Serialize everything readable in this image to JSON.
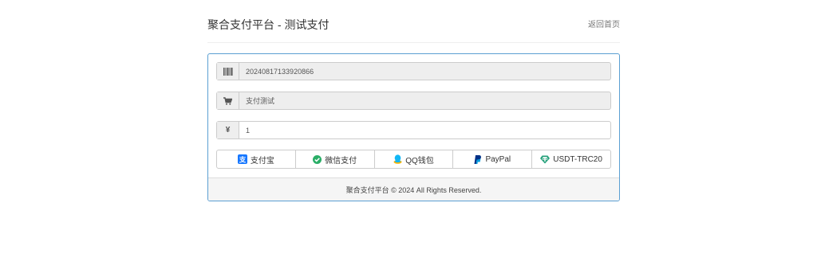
{
  "header": {
    "title": "聚合支付平台 - 测试支付",
    "back_link": "返回首页"
  },
  "form": {
    "order_no": {
      "icon": "barcode-icon",
      "value": "20240817133920866"
    },
    "subject": {
      "icon": "cart-icon",
      "value": "支付测试"
    },
    "amount": {
      "icon": "yen-icon",
      "symbol": "¥",
      "value": "1"
    }
  },
  "payments": [
    {
      "label": "支付宝",
      "icon": "alipay-icon",
      "color": "#1677ff"
    },
    {
      "label": "微信支付",
      "icon": "wechat-icon",
      "color": "#2aae67"
    },
    {
      "label": "QQ钱包",
      "icon": "qq-icon",
      "color": "#12b7f5"
    },
    {
      "label": "PayPal",
      "icon": "paypal-icon",
      "color": "#003087"
    },
    {
      "label": "USDT-TRC20",
      "icon": "tether-icon",
      "color": "#26a17b"
    }
  ],
  "footer": {
    "text": "聚合支付平台 © 2024 All Rights Reserved."
  },
  "colors": {
    "panel_border": "#5b9fd2",
    "footer_bg": "#f5f5f5"
  }
}
